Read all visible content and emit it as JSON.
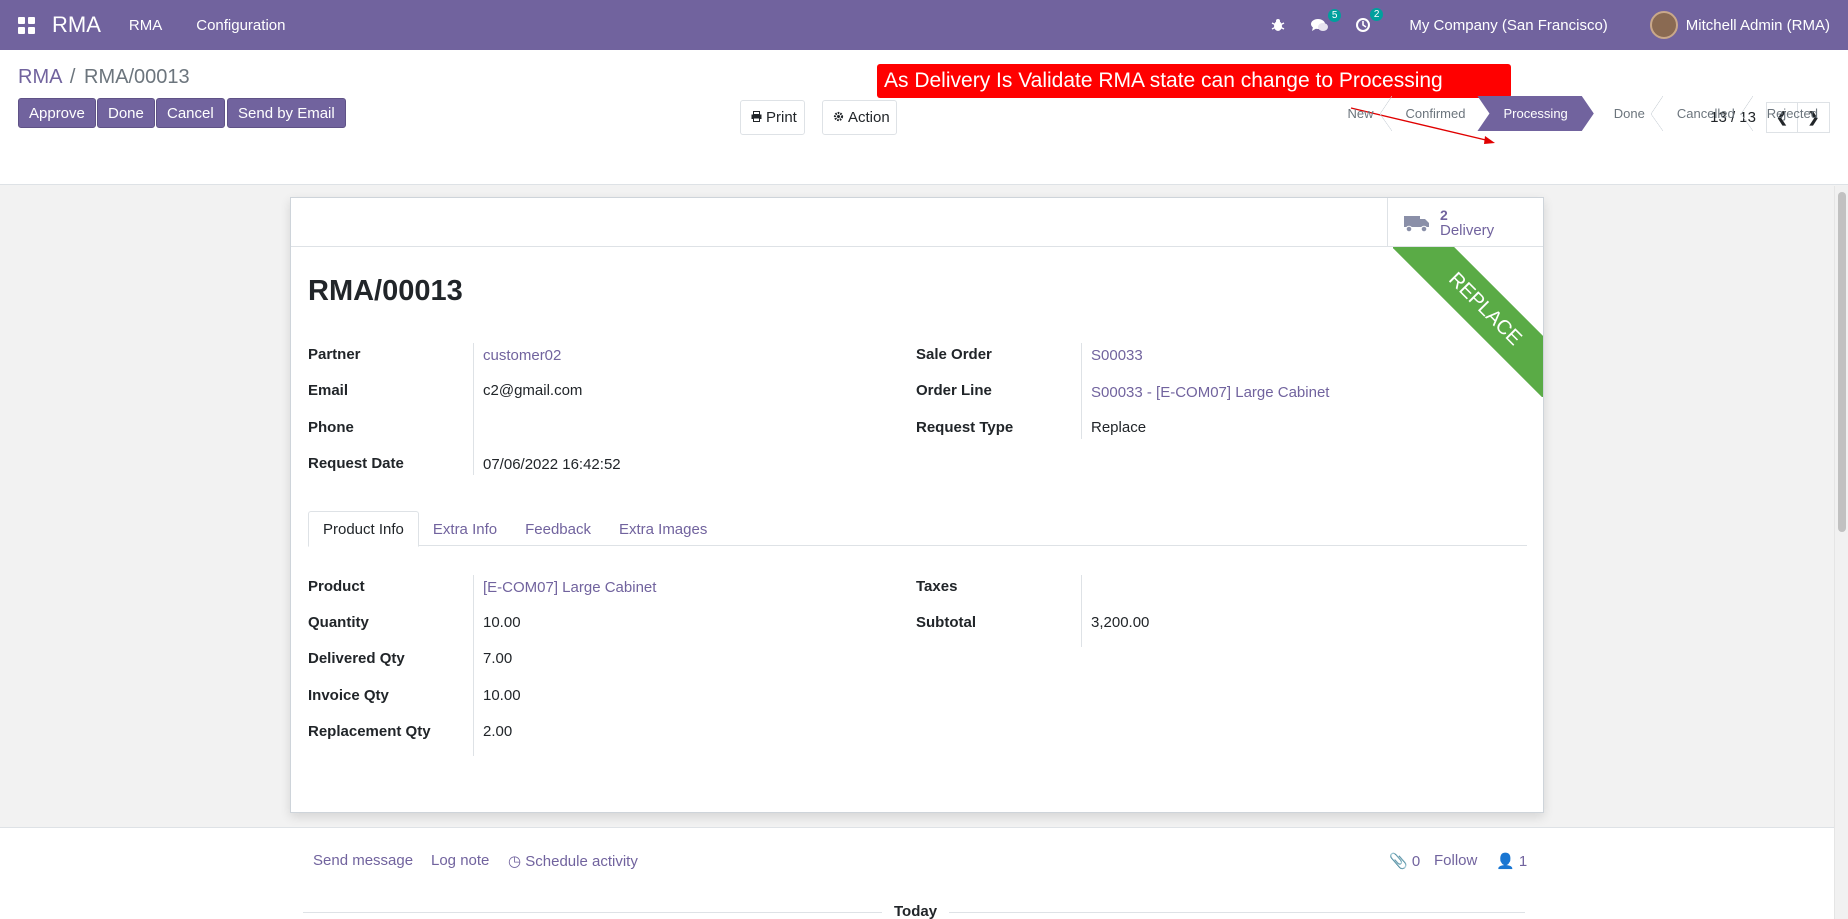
{
  "navbar": {
    "brand": "RMA",
    "menu": [
      "RMA",
      "Configuration"
    ],
    "messages_count": "5",
    "activities_count": "2",
    "company": "My Company (San Francisco)",
    "user": "Mitchell Admin (RMA)"
  },
  "breadcrumb": {
    "parent": "RMA",
    "separator": "/",
    "current": "RMA/00013"
  },
  "toolbar": {
    "print_label": "Print",
    "action_label": "Action"
  },
  "annotation": "As Delivery Is Validate RMA state can change to Processing",
  "pager": {
    "value": "13 / 13"
  },
  "actions": [
    "Approve",
    "Done",
    "Cancel",
    "Send by Email"
  ],
  "statusbar": {
    "stages": [
      "New",
      "Confirmed",
      "Processing",
      "Done",
      "Cancelled",
      "Rejected"
    ],
    "current": "Processing"
  },
  "smart_button": {
    "value": "2",
    "label": "Delivery"
  },
  "ribbon": "REPLACE",
  "record": {
    "title": "RMA/00013",
    "partner_label": "Partner",
    "partner": "customer02",
    "email_label": "Email",
    "email": "c2@gmail.com",
    "phone_label": "Phone",
    "phone": "",
    "request_date_label": "Request Date",
    "request_date": "07/06/2022 16:42:52",
    "sale_order_label": "Sale Order",
    "sale_order": "S00033",
    "order_line_label": "Order Line",
    "order_line": "S00033 - [E-COM07] Large Cabinet",
    "request_type_label": "Request Type",
    "request_type": "Replace"
  },
  "tabs": [
    "Product Info",
    "Extra Info",
    "Feedback",
    "Extra Images"
  ],
  "product_info": {
    "product_label": "Product",
    "product": "[E-COM07] Large Cabinet",
    "quantity_label": "Quantity",
    "quantity": "10.00",
    "delivered_label": "Delivered Qty",
    "delivered": "7.00",
    "invoice_label": "Invoice Qty",
    "invoice": "10.00",
    "replacement_label": "Replacement Qty",
    "replacement": "2.00",
    "taxes_label": "Taxes",
    "taxes": "",
    "subtotal_label": "Subtotal",
    "subtotal": "3,200.00"
  },
  "chatter": {
    "send_message": "Send message",
    "log_note": "Log note",
    "schedule_activity": "Schedule activity",
    "attachments": "0",
    "follow": "Follow",
    "followers": "1",
    "today": "Today"
  },
  "colors": {
    "brand": "#71639e",
    "ribbon": "#5aab46",
    "annotation": "#ff0000"
  }
}
